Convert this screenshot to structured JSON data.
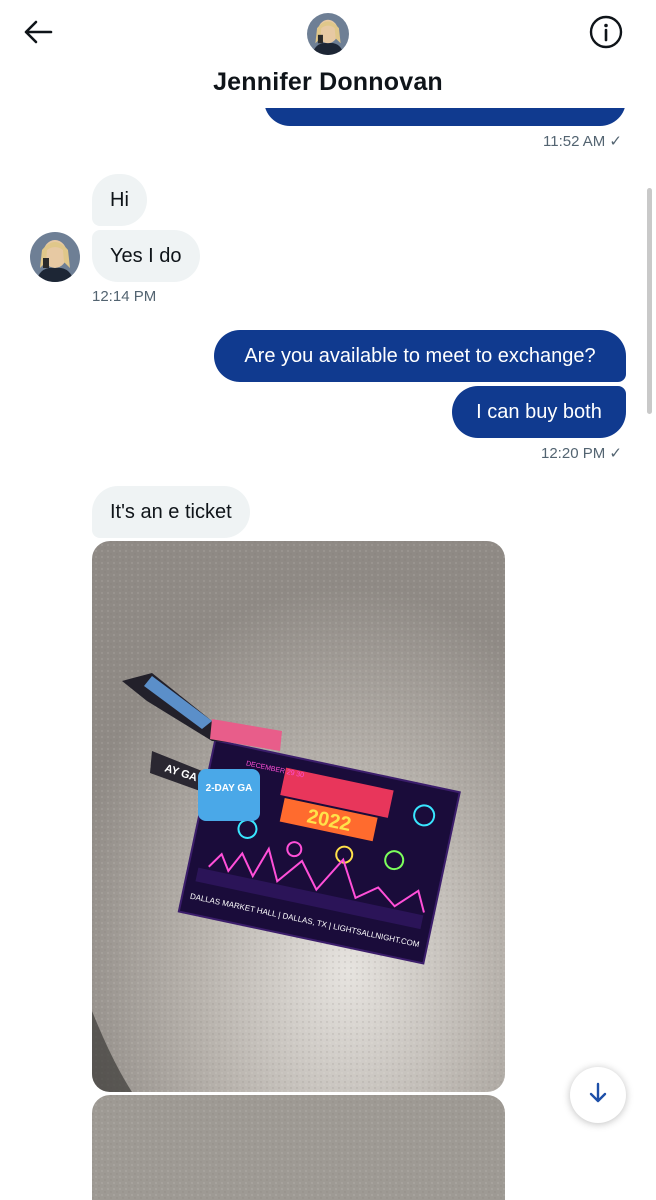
{
  "header": {
    "contact_name": "Jennifer Donnovan",
    "back_icon": "arrow-left-icon",
    "info_icon": "info-icon"
  },
  "messages": [
    {
      "direction": "out",
      "text": "",
      "time": "11:52 AM ✓"
    },
    {
      "direction": "in",
      "text": "Hi"
    },
    {
      "direction": "in",
      "text": "Yes I do",
      "time": "12:14 PM"
    },
    {
      "direction": "out",
      "text": "Are you available to meet to exchange?"
    },
    {
      "direction": "out",
      "text": "I can buy both",
      "time": "12:20 PM ✓"
    },
    {
      "direction": "in",
      "text": "It's an e ticket"
    }
  ],
  "ticket_photo": {
    "wristband_badge": "2-DAY GA",
    "event_year": "2022",
    "event_dates": "DECEMBER 29 30",
    "footer_text": "DALLAS MARKET HALL | DALLAS, TX | LIGHTSALLNIGHT.COM"
  },
  "colors": {
    "outgoing_bubble": "#103a8f",
    "incoming_bubble": "#eff3f4",
    "timestamp": "#536471"
  },
  "scroll_down_icon": "arrow-down-icon"
}
